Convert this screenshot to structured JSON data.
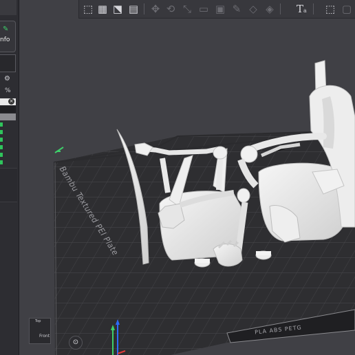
{
  "sidebar": {
    "button_label": "nfo",
    "percent_label": "%",
    "search_clear": "×"
  },
  "toolbar": {
    "text_tool_main": "T",
    "text_tool_sub": "a"
  },
  "plate": {
    "label": "Bambu Textured PEI Plate",
    "filament_label": "PLA ABS PETG"
  },
  "navcube": {
    "top": "Top",
    "front": "Front"
  },
  "colors": {
    "background": "#404045",
    "plate": "#2e2e31",
    "grid": "#4a4a4e",
    "model": "#e9e9e9",
    "accent_green": "#2fc45c"
  }
}
